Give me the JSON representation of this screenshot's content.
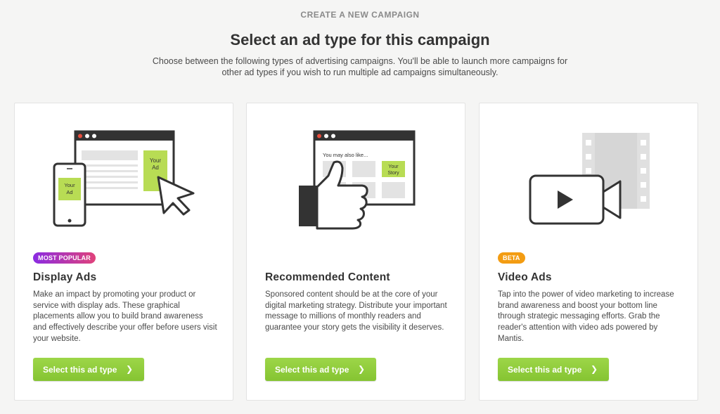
{
  "header": {
    "kicker": "CREATE A NEW CAMPAIGN",
    "title": "Select an ad type for this campaign",
    "subtitle": "Choose between the following types of advertising campaigns. You'll be able to launch more campaigns for other ad types if you wish to run multiple ad campaigns simultaneously."
  },
  "colors": {
    "accent_green": "#8cc63f",
    "ad_tile": "#b8dc54",
    "dark": "#333333",
    "gray_block": "#e0e0e0"
  },
  "cards": [
    {
      "badge": "MOST POPULAR",
      "title": "Display Ads",
      "description": "Make an impact by promoting your product or service with display ads. These graphical placements allow you to build brand awareness and effectively describe your offer before users visit your website.",
      "cta": "Select this ad type",
      "illustration": {
        "icon": "display-ads-illustration",
        "tile_label_1": "Your",
        "tile_label_2": "Ad",
        "phone_label_1": "Your",
        "phone_label_2": "Ad"
      }
    },
    {
      "badge": "",
      "title": "Recommended Content",
      "description": "Sponsored content should be at the core of your digital marketing strategy. Distribute your important message to millions of monthly readers and guarantee your story gets the visibility it deserves.",
      "cta": "Select this ad type",
      "illustration": {
        "icon": "thumbs-up-illustration",
        "heading": "You may also like...",
        "tile_label_1": "Your",
        "tile_label_2": "Story"
      }
    },
    {
      "badge": "BETA",
      "title": "Video Ads",
      "description": "Tap into the power of video marketing to increase brand awareness and boost your bottom line through strategic messaging efforts. Grab the reader's attention with video ads powered by Mantis.",
      "cta": "Select this ad type",
      "illustration": {
        "icon": "video-camera-illustration"
      }
    }
  ]
}
